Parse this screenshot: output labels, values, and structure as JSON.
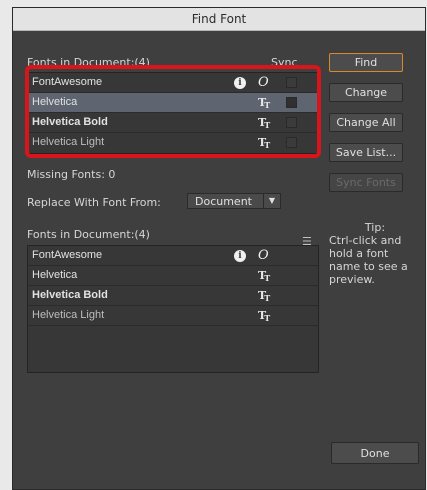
{
  "window": {
    "title": "Find Font"
  },
  "document_fonts": {
    "label": "Fonts in Document:(4)",
    "sync_label": "Sync",
    "rows": [
      {
        "name": "FontAwesome",
        "style": "normal",
        "type": "otf-info-icon",
        "selected": false
      },
      {
        "name": "Helvetica",
        "style": "normal",
        "type": "truetype-icon",
        "selected": true
      },
      {
        "name": "Helvetica Bold",
        "style": "bold",
        "type": "truetype-icon",
        "selected": false
      },
      {
        "name": "Helvetica Light",
        "style": "light",
        "type": "truetype-icon",
        "selected": false
      }
    ]
  },
  "missing_fonts": {
    "label": "Missing Fonts: 0"
  },
  "replace": {
    "label": "Replace With Font From:",
    "selected": "Document"
  },
  "replacement_fonts": {
    "label": "Fonts in Document:(4)",
    "rows": [
      {
        "name": "FontAwesome",
        "style": "normal",
        "type": "otf-info-icon"
      },
      {
        "name": "Helvetica",
        "style": "normal",
        "type": "truetype-icon"
      },
      {
        "name": "Helvetica Bold",
        "style": "bold",
        "type": "truetype-icon"
      },
      {
        "name": "Helvetica Light",
        "style": "light",
        "type": "truetype-icon"
      }
    ]
  },
  "buttons": {
    "find": "Find",
    "change": "Change",
    "change_all": "Change All",
    "save_list": "Save List...",
    "sync_fonts": "Sync Fonts",
    "done": "Done"
  },
  "tip": {
    "title": "Tip:",
    "body": "Ctrl-click and hold a font name to see a preview."
  },
  "icons": {
    "info": "i",
    "otf": "O",
    "truetype": "T"
  },
  "colors": {
    "panel": "#3f3f3f",
    "selected_row": "#5e6470",
    "highlight": "#d9151c",
    "primary_border": "#d58a2b"
  }
}
